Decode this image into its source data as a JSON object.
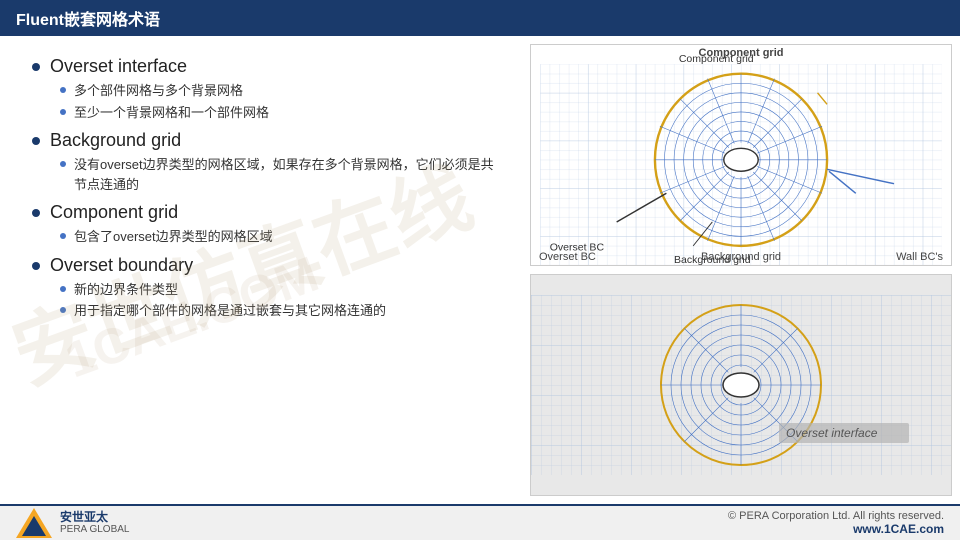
{
  "header": {
    "title": "Fluent嵌套网格术语"
  },
  "bullets": [
    {
      "main": "Overset interface",
      "subs": [
        "多个部件网格与多个背景网格",
        "至少一个背景网格和一个部件网格"
      ]
    },
    {
      "main": "Background grid",
      "subs": [
        "没有overset边界类型的网格区域，如果存在多个背景网格，它们必须是共节点连通的"
      ]
    },
    {
      "main": "Component grid",
      "subs": [
        "包含了overset边界类型的网格区域"
      ]
    },
    {
      "main": "Overset boundary",
      "subs": [
        "新的边界条件类型",
        "用于指定哪个部件的网格是通过嵌套与其它网格连通的"
      ]
    }
  ],
  "diagrams": {
    "top": {
      "labels": {
        "component_grid": "Component grid",
        "overset_bc": "Overset BC",
        "background_grid": "Background grid",
        "wall_bcs": "Wall BC's"
      }
    },
    "bottom": {
      "labels": {
        "overset_interface": "Overset interface"
      }
    }
  },
  "footer": {
    "copyright": "© PERA Corporation Ltd. All rights reserved.",
    "url": "www.1CAE.com",
    "logo_line1": "安世亚太",
    "logo_line2": "PERA GLOBAL"
  },
  "watermark": {
    "line1": "安世仿真在线",
    "line2": "1CAE.COM"
  }
}
